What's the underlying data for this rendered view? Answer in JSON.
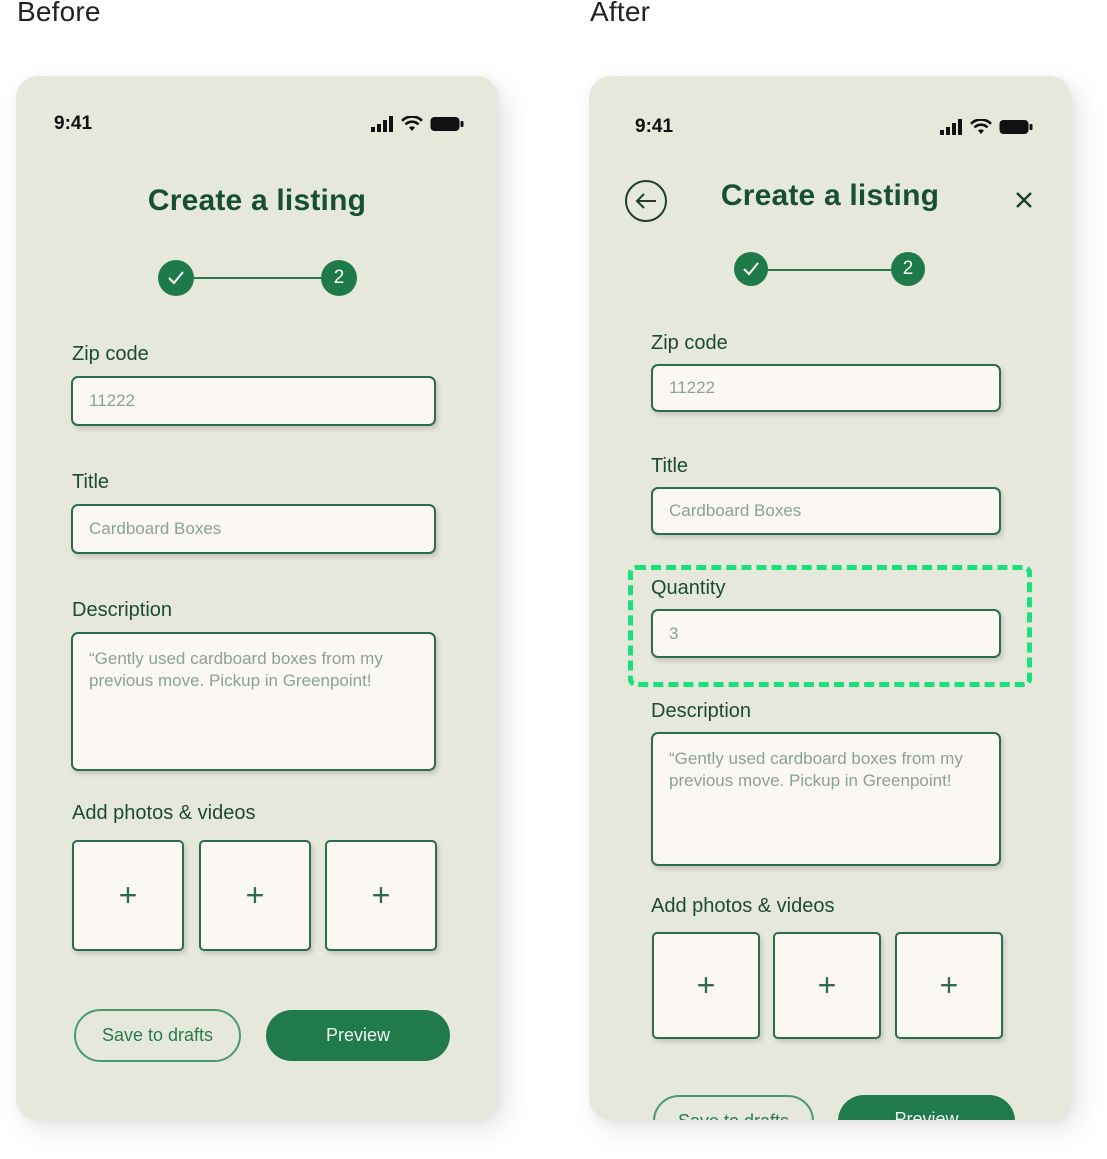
{
  "captions": {
    "before": "Before",
    "after": "After"
  },
  "status": {
    "time": "9:41",
    "icons": [
      "signal-icon",
      "wifi-icon",
      "battery-icon"
    ]
  },
  "form": {
    "title": "Create a listing",
    "steps": {
      "done_icon": "checkmark-icon",
      "current": "2"
    },
    "zip": {
      "label": "Zip code",
      "value": "11222"
    },
    "title_field": {
      "label": "Title",
      "value": "Cardboard Boxes"
    },
    "quantity": {
      "label": "Quantity",
      "value": "3"
    },
    "description": {
      "label": "Description",
      "value": "“Gently used cardboard boxes from my previous move. Pickup in Greenpoint!"
    },
    "photos": {
      "label": "Add photos & videos",
      "add_symbol": "+"
    },
    "save_label": "Save to drafts",
    "preview_label": "Preview"
  },
  "nav": {
    "back_icon": "back-arrow-icon",
    "close_icon": "close-icon"
  },
  "colors": {
    "background": "#e6e8dc",
    "primary": "#217a4c",
    "highlight": "#18e07a",
    "field_bg": "#fbf8f4"
  }
}
